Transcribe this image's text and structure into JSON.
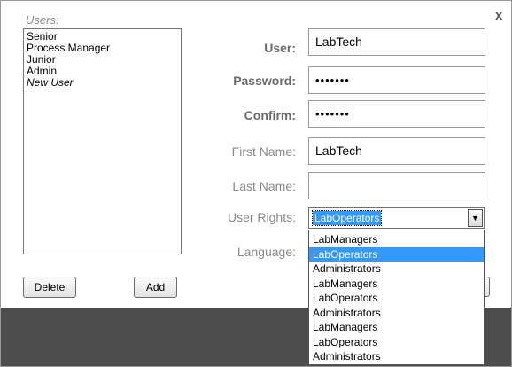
{
  "dialog": {
    "close_label": "x"
  },
  "users": {
    "caption": "Users:",
    "items": [
      {
        "label": "Senior",
        "italic": false
      },
      {
        "label": "Process Manager",
        "italic": false
      },
      {
        "label": "Junior",
        "italic": false
      },
      {
        "label": "Admin",
        "italic": false
      },
      {
        "label": "New User",
        "italic": true
      }
    ],
    "delete_label": "Delete",
    "add_label": "Add"
  },
  "form": {
    "user": {
      "label": "User:",
      "value": "LabTech"
    },
    "password": {
      "label": "Password:",
      "value": "•••••••"
    },
    "confirm": {
      "label": "Confirm:",
      "value": "•••••••"
    },
    "first_name": {
      "label": "First Name:",
      "value": "LabTech"
    },
    "last_name": {
      "label": "Last Name:",
      "value": ""
    },
    "user_rights": {
      "label": "User Rights:",
      "value": "LabOperators",
      "options": [
        "LabManagers",
        "LabOperators",
        "Administrators",
        "LabManagers",
        "LabOperators",
        "Administrators",
        "LabManagers",
        "LabOperators",
        "Administrators"
      ],
      "highlighted_index": 1
    },
    "language": {
      "label": "Language:"
    }
  },
  "colors": {
    "selection": "#3399ff",
    "bottom_band": "#4d4d4d"
  }
}
